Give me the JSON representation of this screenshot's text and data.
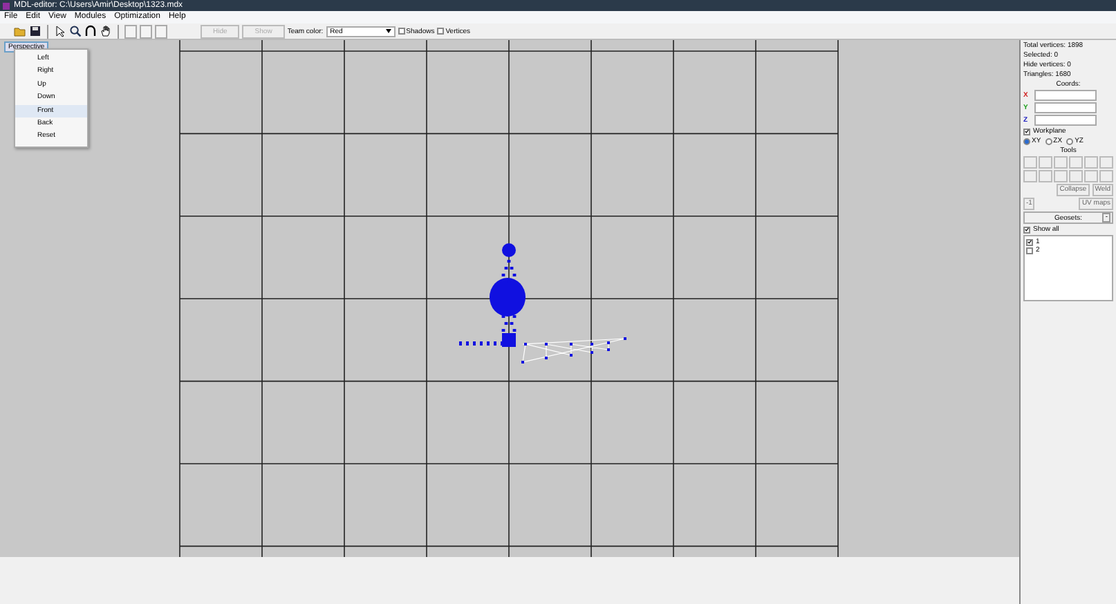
{
  "window": {
    "title": "MDL-editor: C:\\Users\\Amir\\Desktop\\1323.mdx"
  },
  "menu": [
    "File",
    "Edit",
    "View",
    "Modules",
    "Optimization",
    "Help"
  ],
  "toolbar": {
    "buttons": [
      {
        "label": "Hide",
        "disabled": true
      },
      {
        "label": "Show",
        "disabled": true
      }
    ],
    "team_color": {
      "label": "Team color:",
      "value": "Red"
    },
    "checkboxes": [
      {
        "label": "Shadows",
        "checked": false
      },
      {
        "label": "Vertices",
        "checked": false
      }
    ]
  },
  "view_button": {
    "label": "Perspective"
  },
  "view_menu": [
    {
      "label": "Left",
      "selected": false
    },
    {
      "label": "Right",
      "selected": false
    },
    {
      "label": "Up",
      "selected": false
    },
    {
      "label": "Down",
      "selected": false
    },
    {
      "label": "Front",
      "selected": true
    },
    {
      "label": "Back",
      "selected": false
    },
    {
      "label": "Reset",
      "selected": false
    }
  ],
  "stats": [
    "Total vertices: 1898",
    "Selected: 0",
    "Hide vertices: 0",
    "Triangles: 1680"
  ],
  "coords": {
    "title": "Coords:",
    "axes": [
      {
        "label": "X",
        "color": "#d02020"
      },
      {
        "label": "Y",
        "color": "#20a020"
      },
      {
        "label": "Z",
        "color": "#2020c0"
      }
    ]
  },
  "workplane": {
    "label": "Workplane",
    "checked": true,
    "options": [
      {
        "label": "XY",
        "selected": true
      },
      {
        "label": "ZX",
        "selected": false
      },
      {
        "label": "YZ",
        "selected": false
      }
    ]
  },
  "tools": {
    "title": "Tools",
    "buttons": [
      "Collapse",
      "Weld",
      "-1",
      "UV maps"
    ]
  },
  "geosets": {
    "title": "Geosets:",
    "collapse": "-",
    "show_all": {
      "label": "Show all",
      "checked": true
    },
    "items": [
      {
        "label": "1",
        "checked": true
      },
      {
        "label": "2",
        "checked": false
      }
    ]
  }
}
